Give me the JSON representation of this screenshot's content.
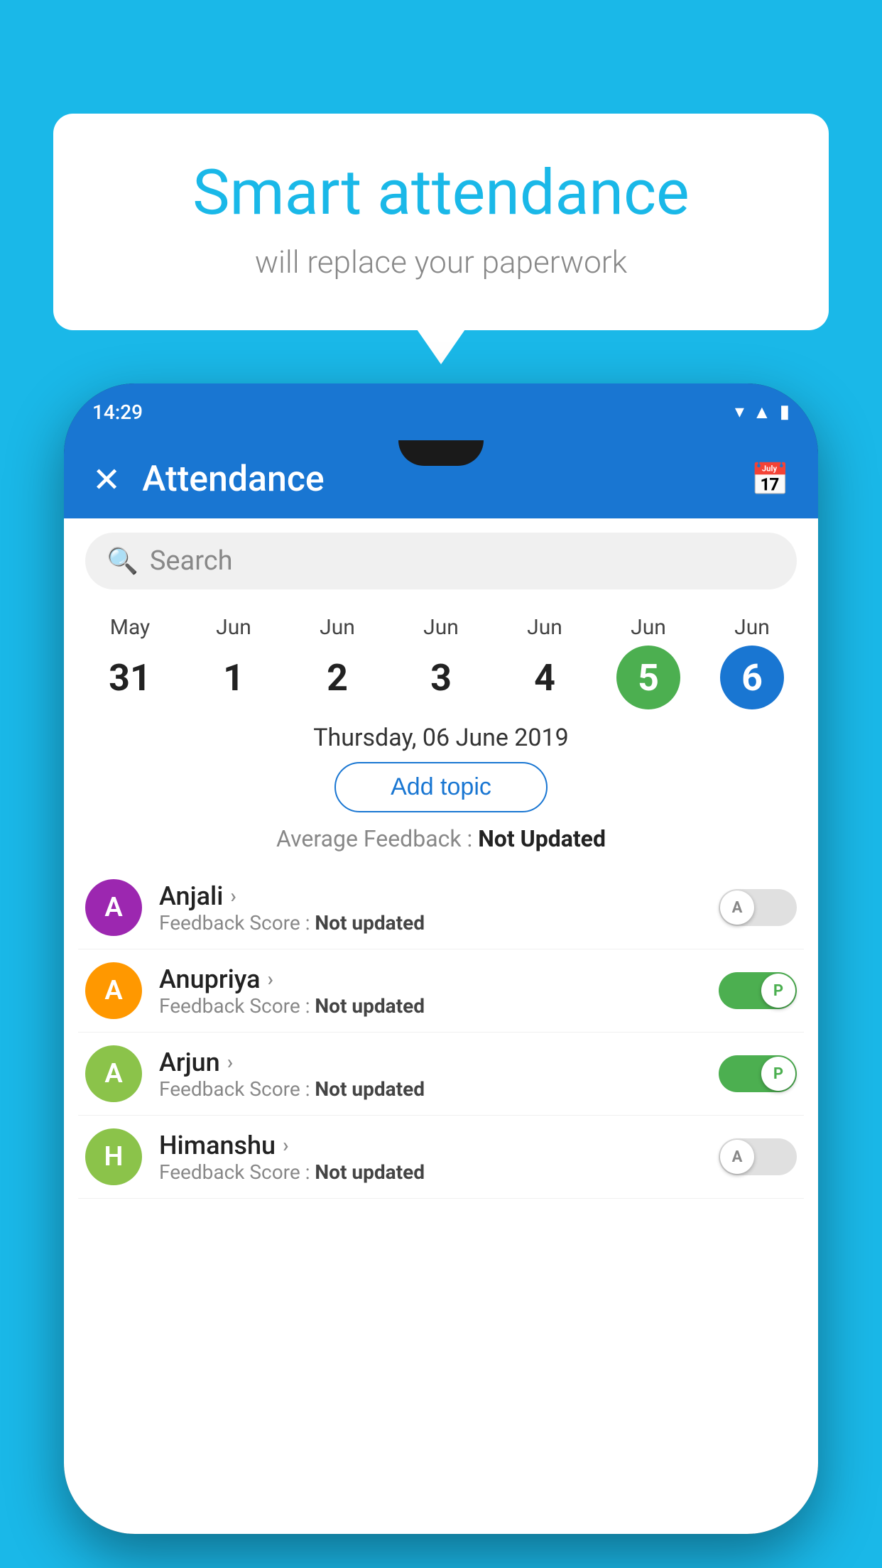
{
  "background_color": "#1ab8e8",
  "speech_bubble": {
    "title": "Smart attendance",
    "subtitle": "will replace your paperwork"
  },
  "status_bar": {
    "time": "14:29",
    "icons": [
      "wifi",
      "signal",
      "battery"
    ]
  },
  "app_bar": {
    "title": "Attendance",
    "close_label": "✕",
    "calendar_icon": "📅"
  },
  "search": {
    "placeholder": "Search"
  },
  "dates": [
    {
      "month": "May",
      "day": "31",
      "state": "normal"
    },
    {
      "month": "Jun",
      "day": "1",
      "state": "normal"
    },
    {
      "month": "Jun",
      "day": "2",
      "state": "normal"
    },
    {
      "month": "Jun",
      "day": "3",
      "state": "normal"
    },
    {
      "month": "Jun",
      "day": "4",
      "state": "normal"
    },
    {
      "month": "Jun",
      "day": "5",
      "state": "today"
    },
    {
      "month": "Jun",
      "day": "6",
      "state": "selected"
    }
  ],
  "selected_date_label": "Thursday, 06 June 2019",
  "add_topic_label": "Add topic",
  "avg_feedback_label": "Average Feedback :",
  "avg_feedback_value": "Not Updated",
  "students": [
    {
      "name": "Anjali",
      "feedback_label": "Feedback Score :",
      "feedback_value": "Not updated",
      "avatar_letter": "A",
      "avatar_color": "#9c27b0",
      "toggle_state": "off",
      "toggle_letter": "A"
    },
    {
      "name": "Anupriya",
      "feedback_label": "Feedback Score :",
      "feedback_value": "Not updated",
      "avatar_letter": "A",
      "avatar_color": "#ff9800",
      "toggle_state": "on",
      "toggle_letter": "P"
    },
    {
      "name": "Arjun",
      "feedback_label": "Feedback Score :",
      "feedback_value": "Not updated",
      "avatar_letter": "A",
      "avatar_color": "#8bc34a",
      "toggle_state": "on",
      "toggle_letter": "P"
    },
    {
      "name": "Himanshu",
      "feedback_label": "Feedback Score :",
      "feedback_value": "Not updated",
      "avatar_letter": "H",
      "avatar_color": "#8bc34a",
      "toggle_state": "off",
      "toggle_letter": "A"
    }
  ]
}
